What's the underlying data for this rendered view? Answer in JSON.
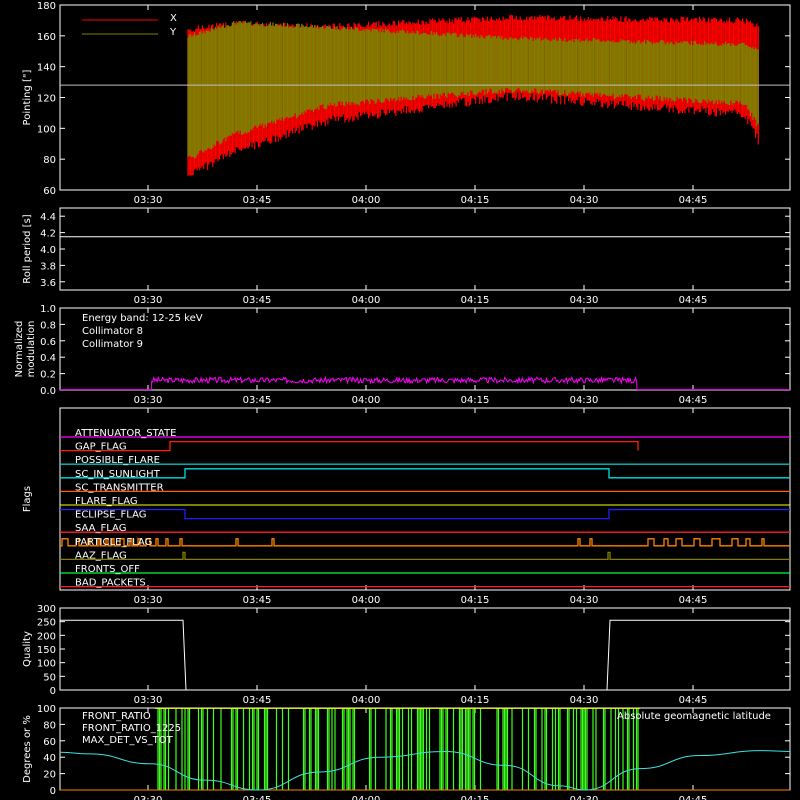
{
  "time_ticks": [
    "03:30",
    "03:45",
    "04:00",
    "04:15",
    "04:30",
    "04:45"
  ],
  "colors": {
    "x": "#ff0000",
    "y": "#808000",
    "flag_on": "#ffff00"
  },
  "panels": {
    "pointing": {
      "ylabel": "Pointing [\"]",
      "yticks": [
        "60",
        "80",
        "100",
        "120",
        "140",
        "160",
        "180"
      ],
      "legend": [
        "X",
        "Y"
      ],
      "ref_line": 128
    },
    "roll": {
      "ylabel": "Roll period [s]",
      "yticks": [
        "3.6",
        "3.8",
        "4.0",
        "4.2",
        "4.4"
      ],
      "value": 4.15
    },
    "modulation": {
      "ylabel1": "Normalized",
      "ylabel2": "modulation",
      "yticks": [
        "0.0",
        "0.2",
        "0.4",
        "0.6",
        "0.8",
        "1.0"
      ],
      "legend": [
        "Energy band: 12-25 keV",
        "Collimator 8",
        "Collimator 9"
      ]
    },
    "flags": {
      "ylabel": "Flags",
      "names": [
        "ATTENUATOR_STATE",
        "GAP_FLAG",
        "POSSIBLE_FLARE",
        "SC_IN_SUNLIGHT",
        "SC_TRANSMITTER",
        "FLARE_FLAG",
        "ECLIPSE_FLAG",
        "SAA_FLAG",
        "PARTICLE_FLAG",
        "AAZ_FLAG",
        "FRONTS_OFF",
        "BAD_PACKETS"
      ],
      "colors": [
        "#ff00ff",
        "#ff2000",
        "#00c0c0",
        "#00e0e0",
        "#ff6000",
        "#ffff40",
        "#2020ff",
        "#ff2020",
        "#ff8000",
        "#808000",
        "#00ff40",
        "#ff2020"
      ]
    },
    "quality": {
      "ylabel": "Quality",
      "yticks": [
        "0",
        "50",
        "100",
        "150",
        "200",
        "250",
        "300"
      ]
    },
    "degrees": {
      "ylabel": "Degrees or %",
      "yticks": [
        "0",
        "20",
        "40",
        "60",
        "80",
        "100"
      ],
      "legend": [
        "FRONT_RATIO",
        "FRONT_RATIO_1225",
        "MAX_DET_VS_TOT"
      ],
      "legend_right": "Absolute geomagnetic latitude"
    }
  },
  "chart_data": [
    {
      "type": "line",
      "ylabel": "Pointing [\"]",
      "ylim": [
        60,
        180
      ],
      "series": [
        {
          "name": "X",
          "envelope": [
            [
              -2,
              -2
            ],
            [
              0.5,
              72,
              162
            ],
            [
              7,
              88,
              166
            ],
            [
              20,
              108,
              164
            ],
            [
              45,
              124,
              170
            ],
            [
              77,
              112,
              168
            ],
            [
              79,
              95,
              165
            ]
          ]
        },
        {
          "name": "Y",
          "envelope": [
            [
              0.5,
              82,
              158
            ],
            [
              7,
              98,
              167
            ],
            [
              20,
              117,
              164
            ],
            [
              45,
              127,
              157
            ],
            [
              77,
              118,
              153
            ],
            [
              79,
              104,
              150
            ]
          ]
        }
      ],
      "x_unit": "minutes since 03:35"
    },
    {
      "type": "line",
      "ylabel": "Roll period [s]",
      "ylim": [
        3.5,
        4.5
      ],
      "values": [
        4.15
      ]
    },
    {
      "type": "line",
      "ylabel": "Normalized modulation",
      "ylim": [
        0,
        1
      ],
      "series": [
        {
          "name": "Collimator 9",
          "value": 0.12
        }
      ]
    },
    {
      "type": "line",
      "ylabel": "Quality",
      "ylim": [
        0,
        300
      ],
      "values": [
        255,
        0,
        255
      ]
    },
    {
      "type": "line",
      "ylabel": "Degrees or %",
      "ylim": [
        0,
        100
      ],
      "series": [
        {
          "name": "Absolute geomagnetic latitude",
          "peaks": [
            46,
            47,
            48
          ],
          "troughs": [
            0,
            0
          ]
        }
      ]
    }
  ]
}
